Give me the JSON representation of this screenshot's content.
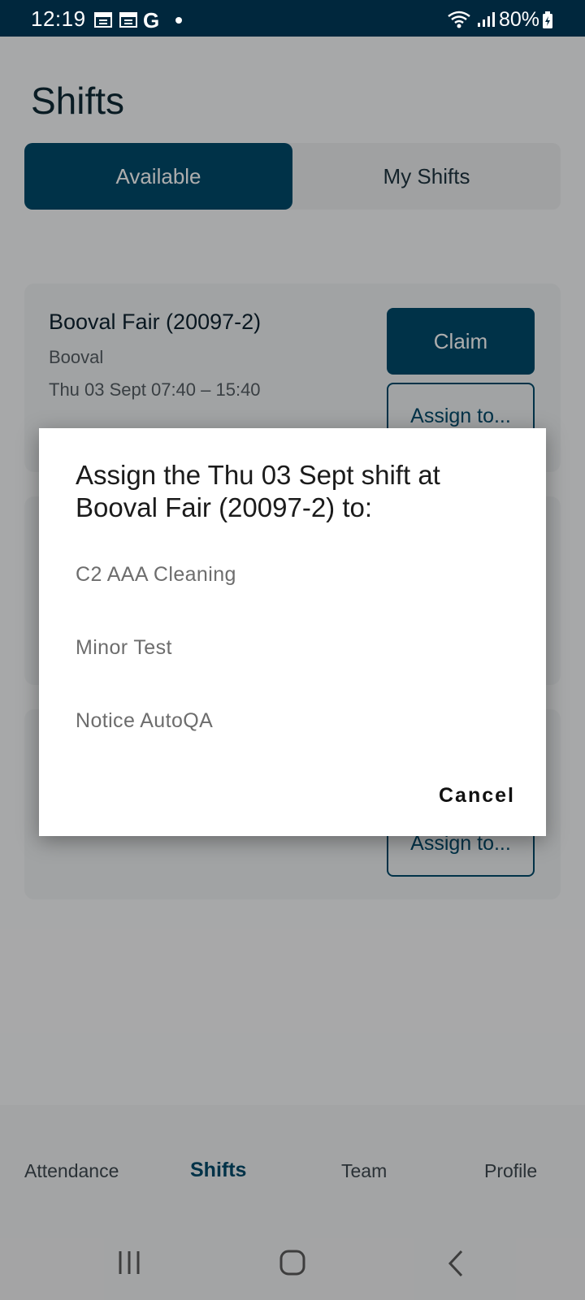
{
  "status_bar": {
    "time": "12:19",
    "icons": [
      "calendar-icon",
      "calendar-icon",
      "google-icon",
      "notification-dot-icon",
      "wifi-icon",
      "signal-icon",
      "battery-icon"
    ],
    "google_letter": "G",
    "battery_text": "80%"
  },
  "page": {
    "title": "Shifts"
  },
  "segment": {
    "available": "Available",
    "my_shifts": "My Shifts",
    "active_color": "#004a6b"
  },
  "cards": [
    {
      "title": "Booval Fair (20097-2)",
      "location": "Booval",
      "time": "Thu 03 Sept  07:40 – 15:40",
      "claim_label": "Claim",
      "assign_label": "Assign to..."
    },
    {
      "assign_label": "Assign to..."
    }
  ],
  "dialog": {
    "title": "Assign the Thu 03 Sept shift at Booval Fair (20097-2) to:",
    "options": [
      "C2 AAA Cleaning",
      "Minor Test",
      "Notice AutoQA"
    ],
    "cancel_label": "Cancel"
  },
  "bottom_nav": {
    "items": [
      {
        "label": "Attendance"
      },
      {
        "label": "Shifts",
        "active": true
      },
      {
        "label": "Team"
      },
      {
        "label": "Profile"
      }
    ]
  },
  "system_nav": {
    "icons": [
      "recent-apps-icon",
      "home-icon",
      "back-icon"
    ]
  },
  "colors": {
    "brand": "#004a6b",
    "status_bar": "#00273d"
  }
}
